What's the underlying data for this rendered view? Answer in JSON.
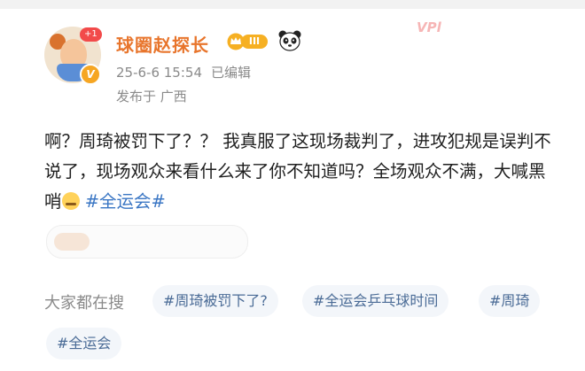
{
  "user": {
    "name": "球圈赵探长",
    "plus_badge": "+1",
    "verified_mark": "V",
    "level": "III",
    "level_icon": "crown-icon",
    "extra_icon": "panda-icon"
  },
  "post_meta": {
    "timestamp": "25-6-6 15:54",
    "edited_label": "已编辑",
    "location": "发布于 广西"
  },
  "post": {
    "text": "啊？周琦被罚下了？？ 我真服了这现场裁判了，进攻犯规是误判不说了，现场观众来看什么来了你不知道吗？全场观众不满，大喊黑哨",
    "emoji": "sad-face-emoji",
    "hashtag": "#全运会#"
  },
  "watermark": {
    "stamp_text": "VPl"
  },
  "search": {
    "label": "大家都在搜",
    "tags": [
      "#周琦被罚下了?",
      "#全运会乒乓球时间",
      "#周琦",
      "#全运会"
    ]
  }
}
